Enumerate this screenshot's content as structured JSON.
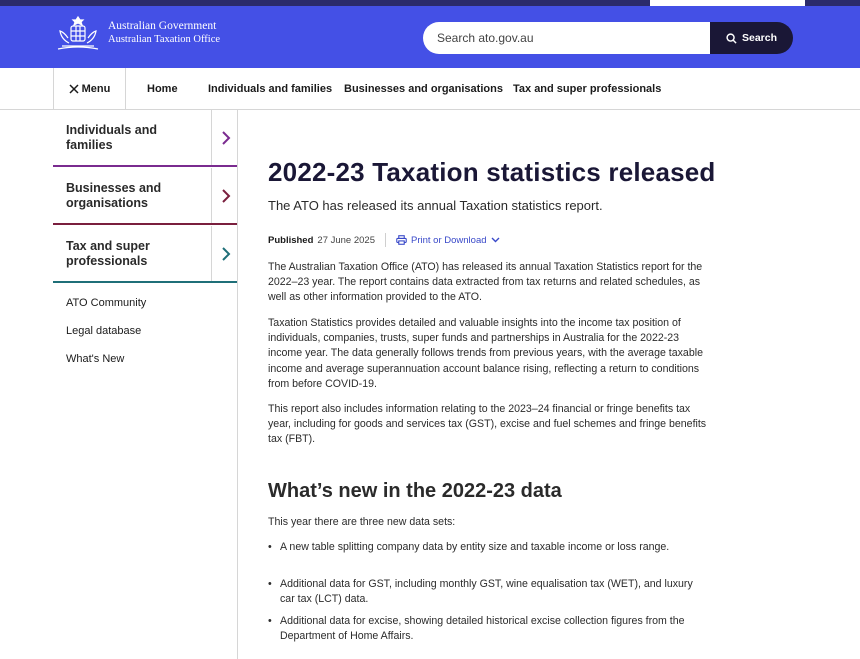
{
  "header": {
    "logo_line1": "Australian Government",
    "logo_line2": "Australian Taxation Office",
    "search_placeholder": "Search ato.gov.au",
    "search_button": "Search",
    "brand_color": "#4450e6"
  },
  "nav": {
    "menu_label": "Menu",
    "items": [
      "Home",
      "Individuals and families",
      "Businesses and organisations",
      "Tax and super professionals"
    ]
  },
  "sidebar": {
    "cards": [
      {
        "label": "Individuals and families",
        "color": "#7a2b8f"
      },
      {
        "label": "Businesses and organisations",
        "color": "#7a1f3e"
      },
      {
        "label": "Tax and super professionals",
        "color": "#1f6f78"
      }
    ],
    "links": [
      "ATO Community",
      "Legal database",
      "What's New"
    ]
  },
  "article": {
    "title": "2022-23 Taxation statistics released",
    "subtitle": "The ATO has released its annual Taxation statistics report.",
    "published_label": "Published",
    "published_date": "27 June 2025",
    "print_label": "Print or Download",
    "paragraphs": [
      "The Australian Taxation Office (ATO) has released its annual Taxation Statistics report for the 2022–23 year. The report contains data extracted from tax returns and related schedules, as well as other information provided to the ATO.",
      "Taxation Statistics provides detailed and valuable insights into the income tax position of individuals, companies, trusts, super funds and partnerships in Australia for the 2022-23 income year. The data generally follows trends from previous years, with the average taxable income and average superannuation account balance rising, reflecting a return to conditions from before COVID-19.",
      "This report also includes information relating to the 2023–24 financial or fringe benefits tax year, including for goods and services tax (GST), excise and fuel schemes and fringe benefits tax (FBT)."
    ],
    "section_title": "What’s new in the 2022-23 data",
    "section_intro": "This year there are three new data sets:",
    "bullets": [
      "A new table splitting company data by entity size and taxable income or loss range.",
      "Additional data for GST, including monthly GST, wine equalisation tax (WET), and luxury car tax (LCT) data.",
      "Additional data for excise, showing detailed historical excise collection figures from the Department of Home Affairs."
    ]
  }
}
